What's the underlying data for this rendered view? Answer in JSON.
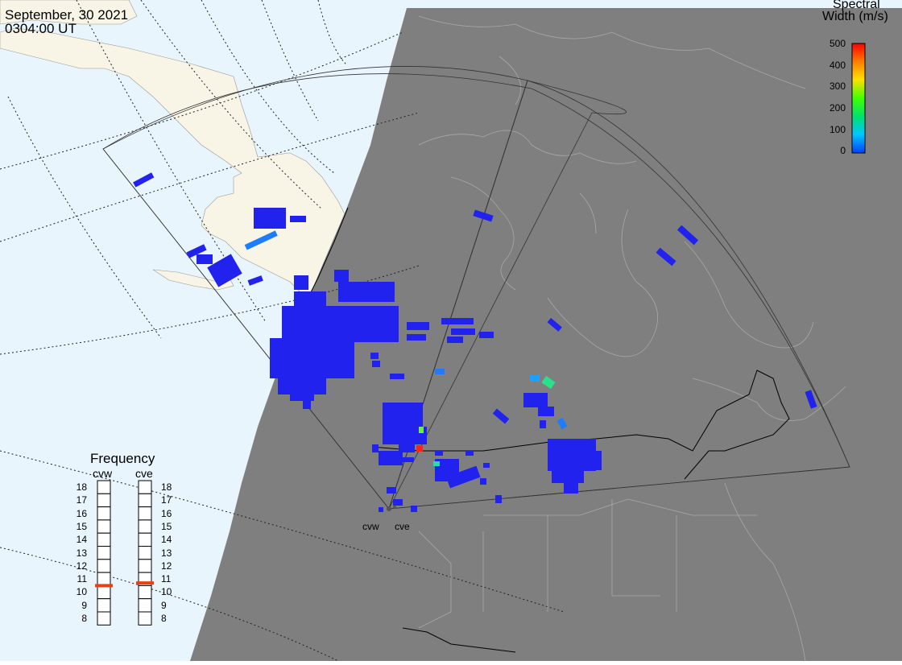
{
  "header": {
    "date": "September, 30 2021",
    "time": "0304:00 UT"
  },
  "colorbar": {
    "title_line1": "Spectral",
    "title_line2": "Width (m/s)",
    "ticks": [
      "500",
      "400",
      "300",
      "200",
      "100",
      "0"
    ],
    "stops": [
      "#0040ff",
      "#00c8ff",
      "#00e070",
      "#40ff00",
      "#ffe000",
      "#ff8000",
      "#ff0000"
    ],
    "range": [
      0,
      500
    ]
  },
  "frequency": {
    "title": "Frequency",
    "radars": [
      {
        "name": "cvw",
        "selected_mhz": 10.5
      },
      {
        "name": "cve",
        "selected_mhz": 10.7
      }
    ],
    "scale": [
      "18",
      "17",
      "16",
      "15",
      "14",
      "13",
      "12",
      "11",
      "10",
      "9",
      "8"
    ],
    "marker_color": "#e84010"
  },
  "sites": [
    {
      "name": "cvw"
    },
    {
      "name": "cve"
    }
  ],
  "map_colors": {
    "ocean": "#e8f5fc",
    "land": "#f8f5e6",
    "night": "#7f7f7f",
    "echo": "#2222ee"
  }
}
